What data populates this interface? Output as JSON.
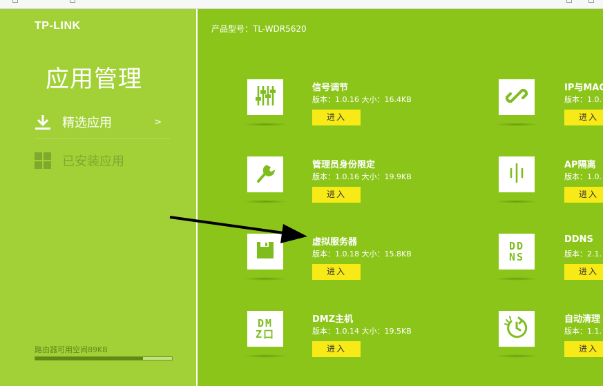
{
  "sidebar": {
    "logo": "TP-LINK",
    "title": "应用管理",
    "nav": [
      {
        "label": "精选应用",
        "chevron": ">"
      },
      {
        "label": "已安装应用"
      }
    ],
    "storage_label": "路由器可用空间89KB",
    "storage_used_fraction": 0.79
  },
  "main": {
    "model": "产品型号：TL-WDR5620",
    "apps": [
      {
        "name": "信号调节",
        "meta": "版本：1.0.16 大小：16.4KB",
        "button": "进入",
        "icon": "sliders-icon"
      },
      {
        "name": "IP与MAC",
        "meta": "版本：1.0.",
        "button": "进入",
        "icon": "link-icon"
      },
      {
        "name": "管理员身份限定",
        "meta": "版本：1.0.16 大小：19.9KB",
        "button": "进入",
        "icon": "wrench-icon"
      },
      {
        "name": "AP隔离",
        "meta": "版本：1.0.",
        "button": "进入",
        "icon": "ap-isolation-icon"
      },
      {
        "name": "虚拟服务器",
        "meta": "版本：1.0.18 大小：15.8KB",
        "button": "进入",
        "icon": "floppy-icon"
      },
      {
        "name": "DDNS",
        "meta": "版本：2.1.",
        "button": "进入",
        "icon": "ddns-icon",
        "icon_text": [
          "DD",
          "NS"
        ]
      },
      {
        "name": "DMZ主机",
        "meta": "版本：1.0.14 大小：19.5KB",
        "button": "进入",
        "icon": "dmz-icon",
        "icon_text": [
          "DM",
          "Z口"
        ]
      },
      {
        "name": "自动清理",
        "meta": "版本：1.1.",
        "button": "进入",
        "icon": "auto-clean-icon"
      }
    ]
  },
  "colors": {
    "sidebar_bg": "#a2d137",
    "main_bg": "#8cc51a",
    "button_bg": "#f7ea16",
    "icon_green": "#7fbd1e"
  }
}
